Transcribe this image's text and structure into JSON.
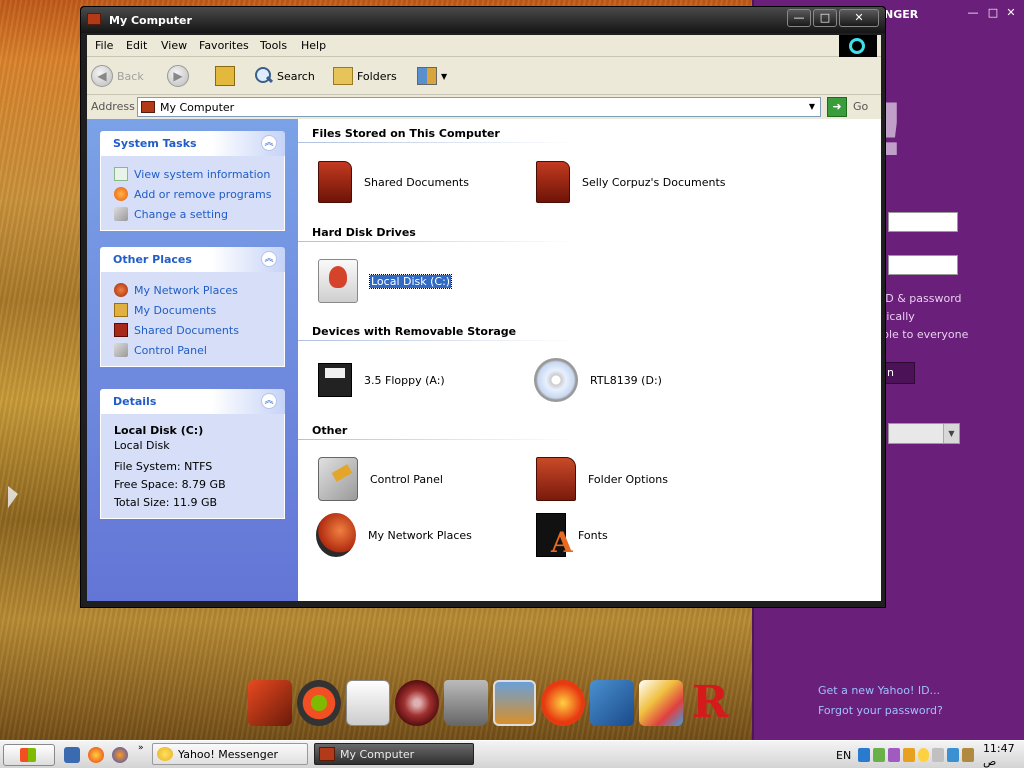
{
  "desktop": {
    "taskbar": {
      "tasks": [
        {
          "label": "Yahoo! Messenger"
        },
        {
          "label": "My Computer"
        }
      ],
      "tray": {
        "language": "EN",
        "clock": "11:47 ص"
      }
    }
  },
  "yahoo": {
    "title_fragment": "NGER",
    "text_lines": [
      "ID & password",
      "tically",
      "ble to everyone"
    ],
    "button_fragment": "n",
    "links": [
      "Get a new Yahoo! ID...",
      "Forgot your password?"
    ]
  },
  "explorer": {
    "title": "My Computer",
    "menu": [
      "File",
      "Edit",
      "View",
      "Favorites",
      "Tools",
      "Help"
    ],
    "toolbar": {
      "back": "Back",
      "search": "Search",
      "folders": "Folders"
    },
    "address": {
      "label": "Address",
      "value": "My Computer",
      "go": "Go"
    },
    "taskpane": {
      "system_tasks": {
        "title": "System Tasks",
        "items": [
          "View system information",
          "Add or remove programs",
          "Change a setting"
        ]
      },
      "other_places": {
        "title": "Other Places",
        "items": [
          "My Network Places",
          "My Documents",
          "Shared Documents",
          "Control Panel"
        ]
      },
      "details": {
        "title": "Details",
        "name": "Local Disk (C:)",
        "type": "Local Disk",
        "file_system": "File System: NTFS",
        "free_space": "Free Space: 8.79 GB",
        "total_size": "Total Size: 11.9 GB"
      }
    },
    "groups": [
      {
        "title": "Files Stored on This Computer",
        "items": [
          "Shared Documents",
          "Selly Corpuz's Documents"
        ]
      },
      {
        "title": "Hard Disk Drives",
        "items": [
          "Local Disk (C:)"
        ]
      },
      {
        "title": "Devices with Removable Storage",
        "items": [
          "3.5 Floppy (A:)",
          "RTL8139 (D:)"
        ]
      },
      {
        "title": "Other",
        "items": [
          "Control Panel",
          "Folder Options",
          "My Network Places",
          "Fonts"
        ]
      }
    ]
  }
}
